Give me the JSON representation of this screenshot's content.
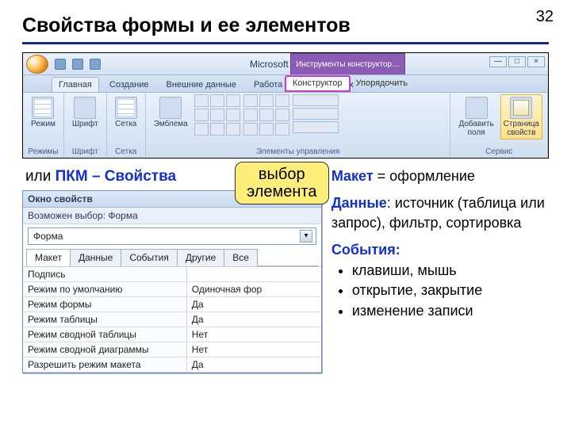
{
  "page_number": "32",
  "heading": "Свойства формы и ее элементов",
  "ribbon": {
    "app_title": "Microsoft Access",
    "context_title": "Инструменты конструктор…",
    "tabs": [
      "Главная",
      "Создание",
      "Внешние данные",
      "Работа с базами данных"
    ],
    "context_tabs": {
      "active": "Конструктор",
      "other": "Упорядочить"
    },
    "win_buttons": [
      "—",
      "□",
      "×"
    ],
    "groups": {
      "g1": {
        "label": "Режимы",
        "btn": "Режим"
      },
      "g2": {
        "label": "Шрифт",
        "btn": "Шрифт"
      },
      "g3": {
        "label": "Сетка",
        "btn": "Сетка"
      },
      "g4": {
        "label": "Элементы управления",
        "btn1": "Эмблема"
      },
      "g5": {
        "label": "Сервис",
        "btn1": "Добавить\nполя",
        "btn2": "Страница\nсвойств"
      }
    }
  },
  "or_line": {
    "prefix": "или ",
    "blue": "ПКМ – Свойства"
  },
  "callout": "выбор\nэлемента",
  "property_sheet": {
    "title": "Окно свойств",
    "close": "×",
    "subtitle": "Возможен выбор:  Форма",
    "combo_value": "Форма",
    "tabs": [
      "Макет",
      "Данные",
      "События",
      "Другие",
      "Все"
    ],
    "active_tab": 0,
    "rows": [
      {
        "k": "Подпись",
        "v": ""
      },
      {
        "k": "Режим по умолчанию",
        "v": "Одиночная фор"
      },
      {
        "k": "Режим формы",
        "v": "Да"
      },
      {
        "k": "Режим таблицы",
        "v": "Да"
      },
      {
        "k": "Режим сводной таблицы",
        "v": "Нет"
      },
      {
        "k": "Режим сводной диаграммы",
        "v": "Нет"
      },
      {
        "k": "Разрешить режим макета",
        "v": "Да"
      }
    ]
  },
  "explain": {
    "maket": {
      "term": "Макет",
      "rest": " = оформление"
    },
    "data": {
      "term": "Данные",
      "rest": ": источник (таблица или запрос), фильтр, сортировка"
    },
    "events": {
      "term": "События:",
      "items": [
        "клавиши, мышь",
        "открытие, закрытие",
        "изменение записи"
      ]
    }
  }
}
